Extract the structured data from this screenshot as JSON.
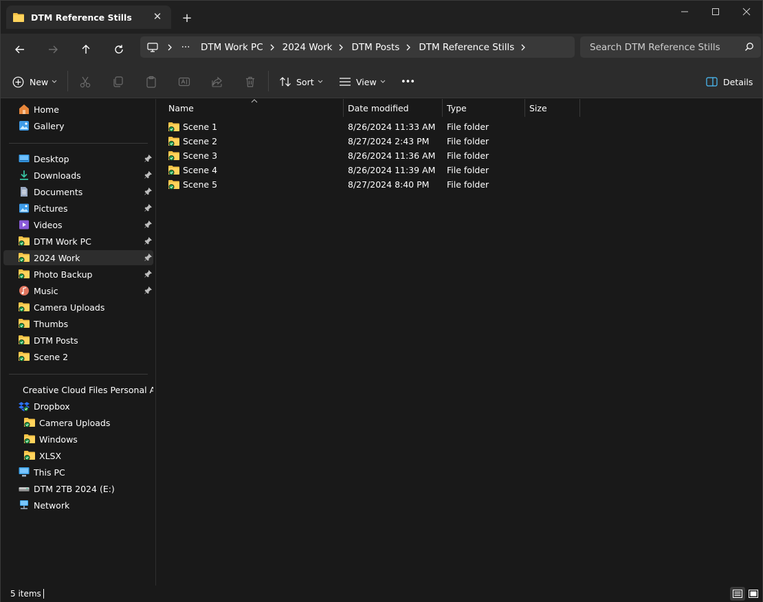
{
  "tab": {
    "title": "DTM Reference Stills",
    "close": "✕",
    "new_tab": "+"
  },
  "window_controls": {
    "minimize": "minimize-icon",
    "maximize": "maximize-icon",
    "close": "close-icon"
  },
  "breadcrumb": {
    "overflow": "···",
    "items": [
      "DTM Work PC",
      "2024 Work",
      "DTM Posts",
      "DTM Reference Stills"
    ]
  },
  "search": {
    "placeholder": "Search DTM Reference Stills"
  },
  "toolbar": {
    "new_label": "New",
    "sort_label": "Sort",
    "view_label": "View",
    "more_label": "•••",
    "details_label": "Details"
  },
  "sidebar": {
    "top": [
      {
        "label": "Home",
        "icon": "home-icon"
      },
      {
        "label": "Gallery",
        "icon": "gallery-icon"
      }
    ],
    "pinned": [
      {
        "label": "Desktop",
        "icon": "desktop-icon",
        "pinned": true
      },
      {
        "label": "Downloads",
        "icon": "downloads-icon",
        "pinned": true
      },
      {
        "label": "Documents",
        "icon": "documents-icon",
        "pinned": true
      },
      {
        "label": "Pictures",
        "icon": "pictures-icon",
        "pinned": true
      },
      {
        "label": "Videos",
        "icon": "videos-icon",
        "pinned": true
      },
      {
        "label": "DTM Work PC",
        "icon": "folder-sync-icon",
        "pinned": true
      },
      {
        "label": "2024 Work",
        "icon": "folder-sync-icon",
        "pinned": true,
        "selected": true
      },
      {
        "label": "Photo Backup",
        "icon": "folder-sync-icon",
        "pinned": true
      },
      {
        "label": "Music",
        "icon": "music-icon",
        "pinned": true
      },
      {
        "label": "Camera Uploads",
        "icon": "folder-sync-icon"
      },
      {
        "label": "Thumbs",
        "icon": "folder-sync-icon"
      },
      {
        "label": "DTM Posts",
        "icon": "folder-sync-icon"
      },
      {
        "label": "Scene 2",
        "icon": "folder-sync-icon"
      }
    ],
    "locations": [
      {
        "label": "Creative Cloud Files Personal Acc",
        "icon": "folder-icon"
      },
      {
        "label": "Dropbox",
        "icon": "dropbox-icon"
      },
      {
        "label": "Camera Uploads",
        "icon": "folder-sync-icon",
        "indent": true
      },
      {
        "label": "Windows",
        "icon": "folder-sync-icon",
        "indent": true
      },
      {
        "label": "XLSX",
        "icon": "folder-sync-icon",
        "indent": true
      },
      {
        "label": "This PC",
        "icon": "this-pc-icon"
      },
      {
        "label": "DTM 2TB 2024 (E:)",
        "icon": "drive-icon"
      },
      {
        "label": "Network",
        "icon": "network-icon"
      }
    ]
  },
  "columns": {
    "name": "Name",
    "date": "Date modified",
    "type": "Type",
    "size": "Size"
  },
  "files": [
    {
      "name": "Scene 1",
      "date": "8/26/2024 11:33 AM",
      "type": "File folder"
    },
    {
      "name": "Scene 2",
      "date": "8/27/2024 2:43 PM",
      "type": "File folder"
    },
    {
      "name": "Scene 3",
      "date": "8/26/2024 11:36 AM",
      "type": "File folder"
    },
    {
      "name": "Scene 4",
      "date": "8/26/2024 11:39 AM",
      "type": "File folder"
    },
    {
      "name": "Scene 5",
      "date": "8/27/2024 8:40 PM",
      "type": "File folder"
    }
  ],
  "status": {
    "items_count": "5 items"
  },
  "colors": {
    "folder": "#f4c145",
    "sync_badge": "#1c9c47",
    "accent": "#4cc2ff"
  }
}
